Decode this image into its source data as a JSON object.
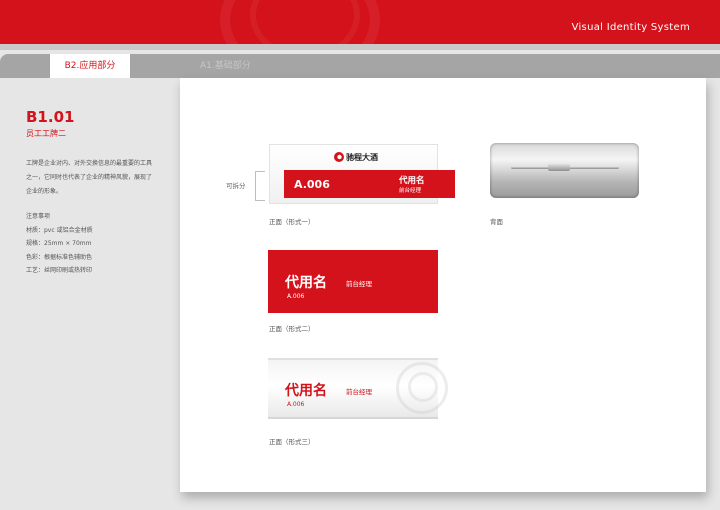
{
  "header": {
    "system_title": "Visual Identity System"
  },
  "tabs": [
    {
      "label": "B2.应用部分",
      "active": true
    },
    {
      "label": "A1.基础部分",
      "active": false
    }
  ],
  "section": {
    "code": "B1.01",
    "title": "员工工牌二",
    "description": "工牌是企业对内、对外交换信息的最重要的工具之一，它同时也代表了企业的精神风貌，展现了企业的形象。",
    "notes_title": "注意事项",
    "notes": [
      "材质：pvc 或铝合金材质",
      "规格：25mm × 70mm",
      "色彩：根据标准色辅助色",
      "工艺：丝网印刷或热转印"
    ]
  },
  "badge_form1": {
    "logo_text": "驰程大酒",
    "code": "A.006",
    "name": "代用名",
    "role": "前台经理",
    "detach_label": "可拆分",
    "caption": "正面（形式一）"
  },
  "badge_back": {
    "caption": "背面"
  },
  "badge_form2": {
    "name": "代用名",
    "role": "前台经理",
    "code": "A.006",
    "caption": "正面（形式二）"
  },
  "badge_form3": {
    "name": "代用名",
    "role": "前台经理",
    "code": "A.006",
    "caption": "正面（形式三）"
  },
  "colors": {
    "brand_red": "#d4121b",
    "panel": "#ffffff",
    "background": "#e6e6e6"
  }
}
